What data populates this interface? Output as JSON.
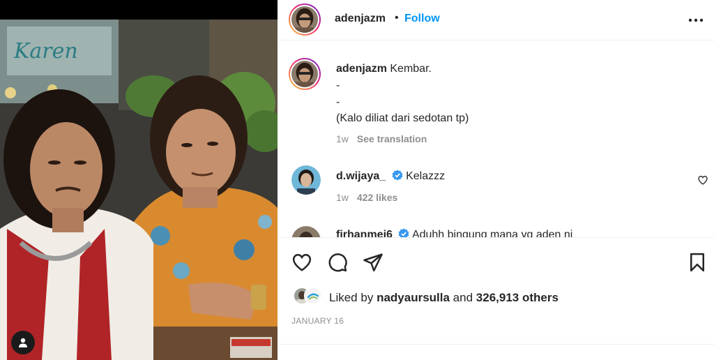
{
  "post": {
    "username": "adenjazm",
    "dot": "•",
    "follow_label": "Follow",
    "more_icon": "more-horizontal-icon"
  },
  "caption": {
    "username": "adenjazm",
    "text": "Kembar.",
    "line2": "-",
    "line3": "-",
    "line4": "(Kalo diliat dari sedotan tp)",
    "time": "1w",
    "translation_label": "See translation"
  },
  "comments": [
    {
      "username": "d.wijaya_",
      "verified": true,
      "text": "Kelazzz",
      "time": "1w",
      "likes": "422 likes"
    },
    {
      "username": "firhanmei6",
      "verified": true,
      "text": "Aduhh bingung mana yg aden ni"
    }
  ],
  "actions": {
    "like_icon": "heart-icon",
    "comment_icon": "comment-icon",
    "share_icon": "send-icon",
    "save_icon": "bookmark-icon"
  },
  "likes": {
    "prefix": "Liked by",
    "user": "nadyaursulla",
    "middle": "and",
    "others": "326,913 others"
  },
  "date": "JANUARY 16",
  "colors": {
    "link_blue": "#0095f6",
    "verified_blue": "#3897f0",
    "muted": "#8e8e8e",
    "text": "#262626"
  }
}
